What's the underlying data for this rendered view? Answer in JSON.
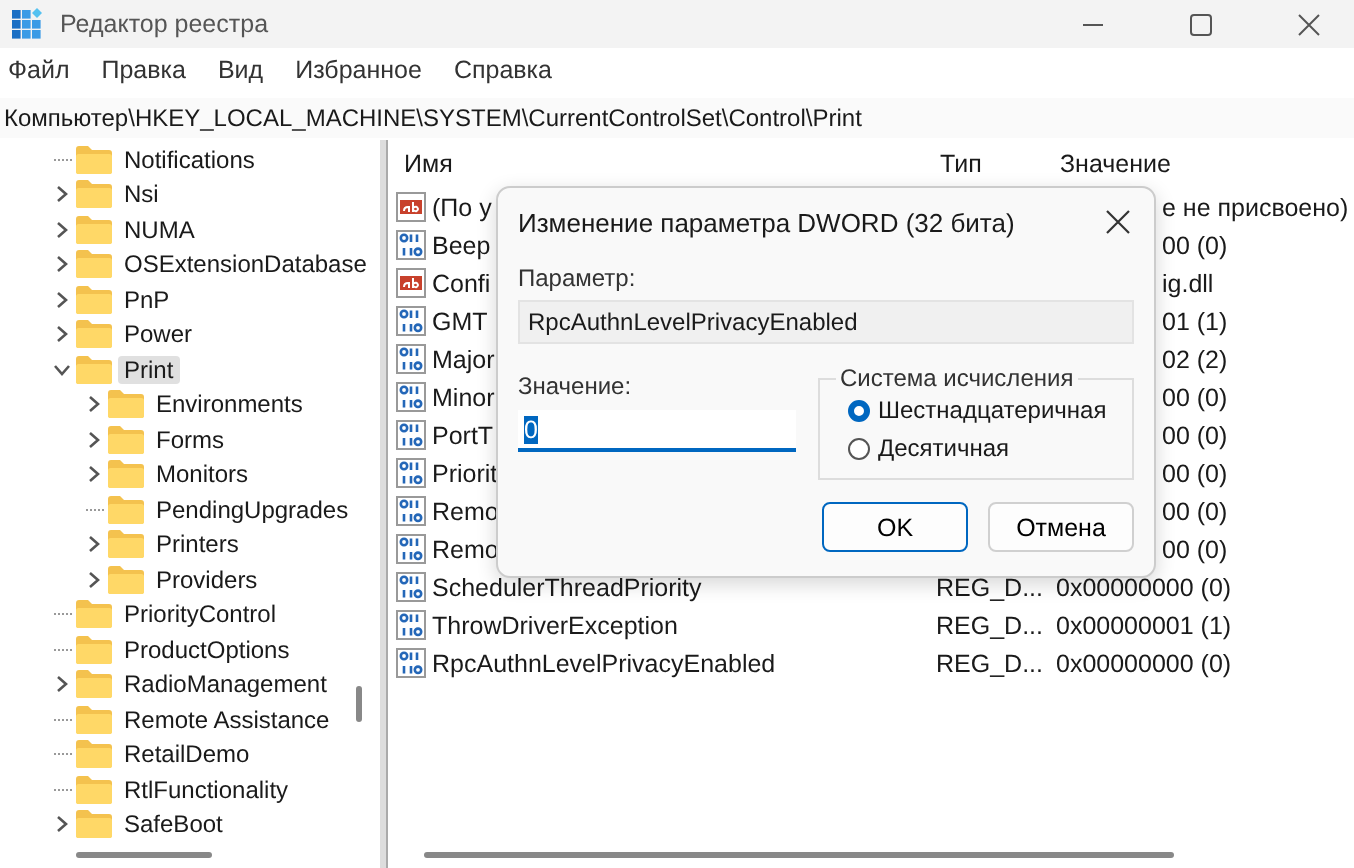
{
  "window": {
    "title": "Редактор реестра"
  },
  "menu": [
    "Файл",
    "Правка",
    "Вид",
    "Избранное",
    "Справка"
  ],
  "address": "Компьютер\\HKEY_LOCAL_MACHINE\\SYSTEM\\CurrentControlSet\\Control\\Print",
  "tree": [
    {
      "label": "Notifications",
      "kind": "leaf",
      "selected": false
    },
    {
      "label": "Nsi",
      "kind": "branch",
      "expanded": false,
      "selected": false
    },
    {
      "label": "NUMA",
      "kind": "branch",
      "expanded": false,
      "selected": false
    },
    {
      "label": "OSExtensionDatabase",
      "kind": "branch",
      "expanded": false,
      "selected": false
    },
    {
      "label": "PnP",
      "kind": "branch",
      "expanded": false,
      "selected": false
    },
    {
      "label": "Power",
      "kind": "branch",
      "expanded": false,
      "selected": false
    },
    {
      "label": "Print",
      "kind": "branch",
      "expanded": true,
      "selected": true,
      "children": [
        {
          "label": "Environments",
          "kind": "branch",
          "expanded": false,
          "selected": false
        },
        {
          "label": "Forms",
          "kind": "branch",
          "expanded": false,
          "selected": false
        },
        {
          "label": "Monitors",
          "kind": "branch",
          "expanded": false,
          "selected": false
        },
        {
          "label": "PendingUpgrades",
          "kind": "leaf",
          "selected": false
        },
        {
          "label": "Printers",
          "kind": "branch",
          "expanded": false,
          "selected": false
        },
        {
          "label": "Providers",
          "kind": "branch",
          "expanded": false,
          "selected": false
        }
      ]
    },
    {
      "label": "PriorityControl",
      "kind": "leaf",
      "selected": false
    },
    {
      "label": "ProductOptions",
      "kind": "leaf",
      "selected": false
    },
    {
      "label": "RadioManagement",
      "kind": "branch",
      "expanded": false,
      "selected": false
    },
    {
      "label": "Remote Assistance",
      "kind": "leaf",
      "selected": false
    },
    {
      "label": "RetailDemo",
      "kind": "leaf",
      "selected": false
    },
    {
      "label": "RtlFunctionality",
      "kind": "leaf",
      "selected": false
    },
    {
      "label": "SafeBoot",
      "kind": "branch",
      "expanded": false,
      "selected": false
    }
  ],
  "table": {
    "columns": [
      "Имя",
      "Тип",
      "Значение"
    ],
    "rows": [
      {
        "kind": "string",
        "name": "(По у",
        "value": "е не присвоено)"
      },
      {
        "kind": "number",
        "name": "Beep",
        "value": "00 (0)"
      },
      {
        "kind": "string",
        "name": "Confi",
        "value": "ig.dll"
      },
      {
        "kind": "number",
        "name": "GMT",
        "value": "01 (1)"
      },
      {
        "kind": "number",
        "name": "Major",
        "value": "02 (2)"
      },
      {
        "kind": "number",
        "name": "Minor",
        "value": "00 (0)"
      },
      {
        "kind": "number",
        "name": "PortT",
        "value": "00 (0)"
      },
      {
        "kind": "number",
        "name": "Priorit",
        "value": "00 (0)"
      },
      {
        "kind": "number",
        "name": "Remo",
        "value": "00 (0)"
      },
      {
        "kind": "number",
        "name": "Remo",
        "value": "00 (0)"
      },
      {
        "kind": "number",
        "name": "SchedulerThreadPriority",
        "type": "REG_D...",
        "value": "0x00000000 (0)"
      },
      {
        "kind": "number",
        "name": "ThrowDriverException",
        "type": "REG_D...",
        "value": "0x00000001 (1)"
      },
      {
        "kind": "number",
        "name": "RpcAuthnLevelPrivacyEnabled",
        "type": "REG_D...",
        "value": "0x00000000 (0)"
      }
    ]
  },
  "dialog": {
    "title": "Изменение параметра DWORD (32 бита)",
    "parameter_label": "Параметр:",
    "parameter": "RpcAuthnLevelPrivacyEnabled",
    "value_label": "Значение:",
    "value": "0",
    "base_group": {
      "title": "Система исчисления",
      "options": [
        {
          "label": "Шестнадцатеричная",
          "selected": true
        },
        {
          "label": "Десятичная",
          "selected": false
        }
      ]
    },
    "buttons": [
      {
        "label": "OK",
        "primary": true
      },
      {
        "label": "Отмена",
        "primary": false
      }
    ]
  }
}
